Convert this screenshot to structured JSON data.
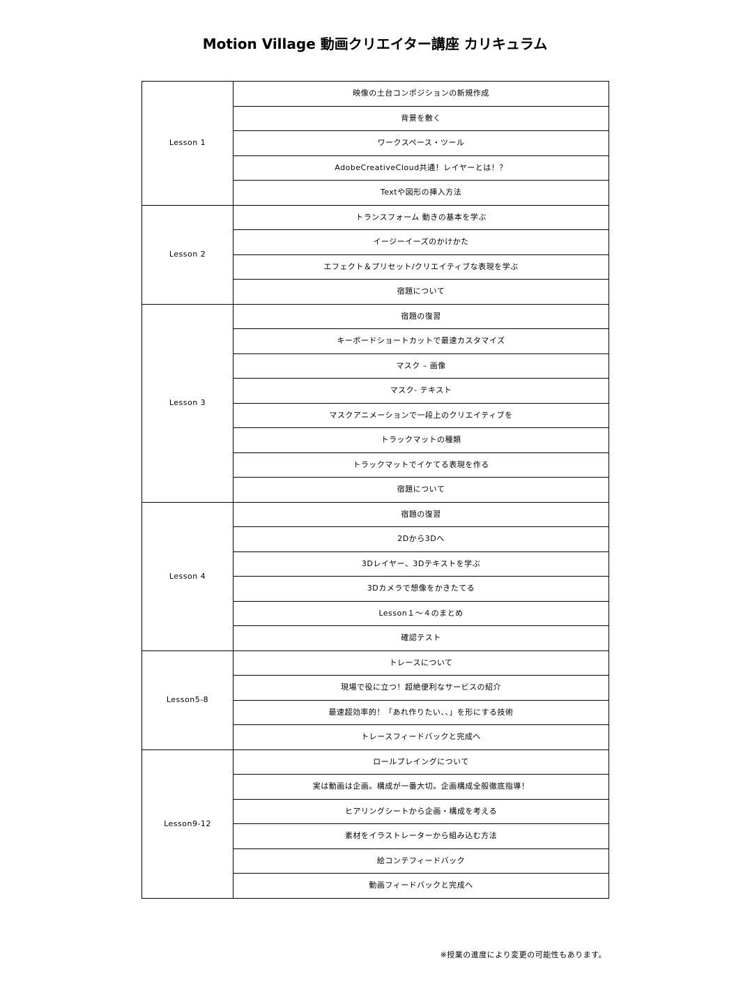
{
  "document": {
    "title": "Motion Village 動画クリエイター講座 カリキュラム",
    "footnote": "※授業の進度により変更の可能性もあります。"
  },
  "lessons": [
    {
      "name": "Lesson 1",
      "topics": [
        "映像の土台コンポジションの新規作成",
        "背景を敷く",
        "ワークスペース・ツール",
        "AdobeCreativeCloud共通！レイヤーとは！？",
        "Textや図形の挿入方法"
      ]
    },
    {
      "name": "Lesson 2",
      "topics": [
        "トランスフォーム 動きの基本を学ぶ",
        "イージーイーズのかけかた",
        "エフェクト＆プリセット/クリエイティブな表現を学ぶ",
        "宿題について"
      ]
    },
    {
      "name": "Lesson 3",
      "topics": [
        "宿題の復習",
        "キーボードショートカットで最速カスタマイズ",
        "マスク – 画像",
        "マスク- テキスト",
        "マスクアニメーションで一段上のクリエイティブを",
        "トラックマットの種類",
        "トラックマットでイケてる表現を作る",
        "宿題について"
      ]
    },
    {
      "name": "Lesson 4",
      "topics": [
        "宿題の復習",
        "2Dから3Dへ",
        "3Dレイヤー、3Dテキストを学ぶ",
        "3Dカメラで想像をかきたてる",
        "Lesson１～４のまとめ",
        "確認テスト"
      ]
    },
    {
      "name": "Lesson5-8",
      "topics": [
        "トレースについて",
        "現場で役に立つ！超絶便利なサービスの紹介",
        "最速超効率的！「あれ作りたい、、」を形にする技術",
        "トレースフィードバックと完成へ"
      ]
    },
    {
      "name": "Lesson9-12",
      "topics": [
        "ロールプレイングについて",
        "実は動画は企画。構成が一番大切。企画構成全般徹底指導！",
        "ヒアリングシートから企画・構成を考える",
        "素材をイラストレーターから組み込む方法",
        "絵コンテフィードバック",
        "動画フィードバックと完成へ"
      ]
    }
  ]
}
